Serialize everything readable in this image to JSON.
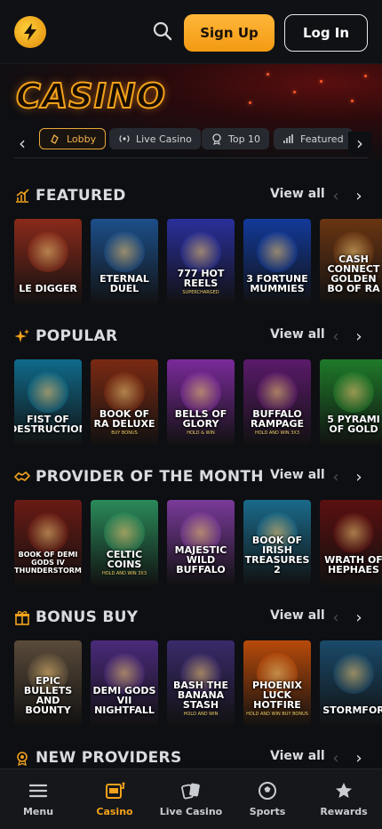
{
  "header": {
    "logo_icon": "lightning-bolt-icon",
    "signup_label": "Sign Up",
    "login_label": "Log In"
  },
  "hero": {
    "title": "CASINO"
  },
  "tabs": [
    {
      "label": "Lobby",
      "icon": "lobby-icon",
      "active": true
    },
    {
      "label": "Live Casino",
      "icon": "broadcast-icon"
    },
    {
      "label": "Top 10",
      "icon": "medal-icon"
    },
    {
      "label": "Featured",
      "icon": "chart-icon"
    }
  ],
  "view_all_label": "View all",
  "sections": [
    {
      "title": "FEATURED",
      "icon": "bar-chart-icon",
      "games": [
        {
          "title": "LE DIGGER",
          "sub": "",
          "color": "#8a2a1a"
        },
        {
          "title": "ETERNAL DUEL",
          "sub": "",
          "color": "#1d4f8a"
        },
        {
          "title": "777 HOT REELS",
          "sub": "SUPERCHARGED",
          "color": "#2a2f9a"
        },
        {
          "title": "3 FORTUNE MUMMIES",
          "sub": "",
          "color": "#123a9a"
        },
        {
          "title": "CASH CONNECT GOLDEN BO OF RA",
          "sub": "",
          "color": "#6a3512"
        }
      ]
    },
    {
      "title": "POPULAR",
      "icon": "sparkle-icon",
      "games": [
        {
          "title": "FIST OF DESTRUCTION",
          "sub": "",
          "color": "#0f6a8a"
        },
        {
          "title": "BOOK OF RA DELUXE",
          "sub": "BUY BONUS",
          "color": "#7a2a12"
        },
        {
          "title": "BELLS OF GLORY",
          "sub": "HOLD & WIN",
          "color": "#7a2a9a"
        },
        {
          "title": "BUFFALO RAMPAGE",
          "sub": "HOLD AND WIN 3X3",
          "color": "#5a1a6a"
        },
        {
          "title": "5 PYRAMI OF GOLD",
          "sub": "",
          "color": "#1f7a2a"
        }
      ]
    },
    {
      "title": "PROVIDER OF THE MONTH",
      "icon": "handshake-icon",
      "games": [
        {
          "title": "BOOK OF DEMI GODS IV THUNDERSTORM",
          "sub": "",
          "color": "#6a1a14"
        },
        {
          "title": "CELTIC COINS",
          "sub": "HOLD AND WIN 3X3",
          "color": "#2a8a5a"
        },
        {
          "title": "MAJESTIC WILD BUFFALO",
          "sub": "",
          "color": "#7a3a9a"
        },
        {
          "title": "BOOK OF IRISH TREASURES 2",
          "sub": "",
          "color": "#1a6a8a"
        },
        {
          "title": "WRATH OF HEPHAES",
          "sub": "",
          "color": "#5a1010"
        }
      ]
    },
    {
      "title": "BONUS BUY",
      "icon": "gift-icon",
      "games": [
        {
          "title": "EPIC BULLETS AND BOUNTY",
          "sub": "",
          "color": "#5a4a3a"
        },
        {
          "title": "DEMI GODS VII NIGHTFALL",
          "sub": "",
          "color": "#4a2a7a"
        },
        {
          "title": "BASH THE BANANA STASH",
          "sub": "HOLD AND WIN",
          "color": "#3a2a6a"
        },
        {
          "title": "PHOENIX LUCK HOTFIRE",
          "sub": "HOLD AND WIN BUY BONUS",
          "color": "#b84a0a"
        },
        {
          "title": "STORMFOR",
          "sub": "",
          "color": "#1a4a6a"
        }
      ]
    },
    {
      "title": "NEW PROVIDERS",
      "icon": "gear-badge-icon",
      "games": []
    }
  ],
  "bottom_nav": [
    {
      "label": "Menu",
      "icon": "hamburger-icon"
    },
    {
      "label": "Casino",
      "icon": "slot-machine-icon",
      "active": true
    },
    {
      "label": "Live Casino",
      "icon": "cards-icon"
    },
    {
      "label": "Sports",
      "icon": "soccer-ball-icon"
    },
    {
      "label": "Rewards",
      "icon": "star-icon"
    }
  ],
  "colors": {
    "accent": "#f2a21b",
    "background": "#0d0f12",
    "tab_bg": "#262a30"
  }
}
